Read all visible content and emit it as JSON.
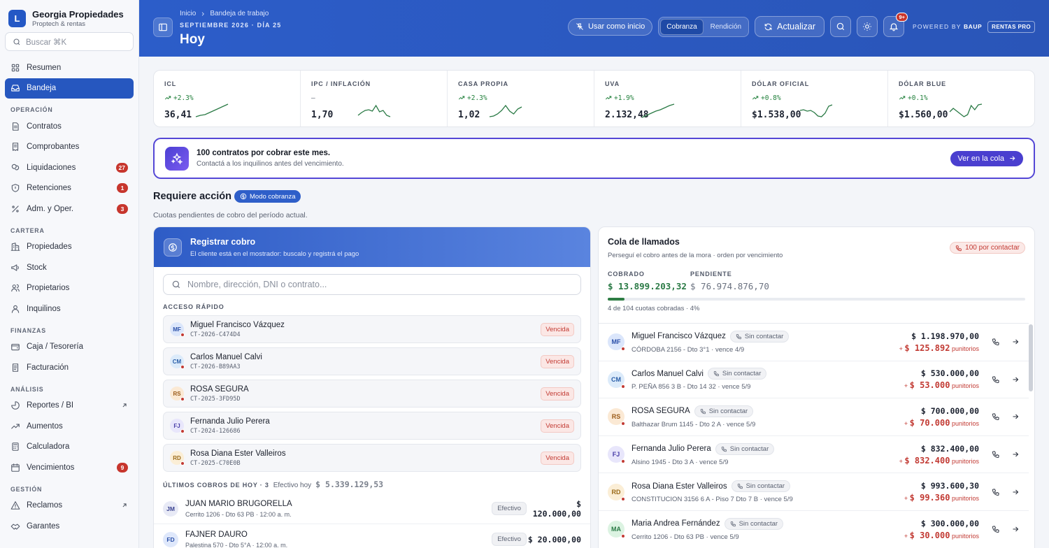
{
  "brand": {
    "logo": "L",
    "name": "Georgia Propiedades",
    "tagline": "Proptech & rentas"
  },
  "sidebar": {
    "search_placeholder": "Buscar ⌘K",
    "top_items": [
      {
        "label": "Resumen",
        "icon": "grid-icon"
      },
      {
        "label": "Bandeja",
        "icon": "inbox-icon",
        "active": true
      }
    ],
    "sections": [
      {
        "title": "OPERACIÓN",
        "items": [
          {
            "label": "Contratos",
            "icon": "document-icon"
          },
          {
            "label": "Comprobantes",
            "icon": "receipt-icon"
          },
          {
            "label": "Liquidaciones",
            "icon": "coins-icon",
            "badge": "27"
          },
          {
            "label": "Retenciones",
            "icon": "shield-icon",
            "badge": "1"
          },
          {
            "label": "Adm. y Oper.",
            "icon": "percent-icon",
            "badge": "3"
          }
        ]
      },
      {
        "title": "CARTERA",
        "items": [
          {
            "label": "Propiedades",
            "icon": "building-icon"
          },
          {
            "label": "Stock",
            "icon": "megaphone-icon"
          },
          {
            "label": "Propietarios",
            "icon": "users-icon"
          },
          {
            "label": "Inquilinos",
            "icon": "user-icon"
          }
        ]
      },
      {
        "title": "FINANZAS",
        "items": [
          {
            "label": "Caja / Tesorería",
            "icon": "wallet-icon"
          },
          {
            "label": "Facturación",
            "icon": "invoice-icon"
          }
        ]
      },
      {
        "title": "ANÁLISIS",
        "items": [
          {
            "label": "Reportes / BI",
            "icon": "chart-icon",
            "external": true
          },
          {
            "label": "Aumentos",
            "icon": "trend-up-icon"
          },
          {
            "label": "Calculadora",
            "icon": "calculator-icon"
          },
          {
            "label": "Vencimientos",
            "icon": "calendar-icon",
            "badge": "9"
          }
        ]
      },
      {
        "title": "GESTIÓN",
        "items": [
          {
            "label": "Reclamos",
            "icon": "warning-icon",
            "external": true
          },
          {
            "label": "Garantes",
            "icon": "handshake-icon"
          }
        ]
      }
    ]
  },
  "header": {
    "breadcrumb": [
      "Inicio",
      "Bandeja de trabajo"
    ],
    "date": "SEPTIEMBRE 2026 · DÍA 25",
    "title": "Hoy",
    "use_as_home": "Usar como inicio",
    "segments": [
      "Cobranza",
      "Rendición"
    ],
    "refresh": "Actualizar",
    "notif_count": "9+",
    "powered": "POWERED BY",
    "powered_brand": "BAUP",
    "plan": "RENTAS PRO"
  },
  "indicators": [
    {
      "name": "ICL",
      "change": "+2.3%",
      "value": "36,41",
      "trend": [
        0.1,
        0.2,
        0.25,
        0.4,
        0.55,
        0.7,
        0.85,
        1.0
      ]
    },
    {
      "name": "IPC / INFLACIÓN",
      "change": "–",
      "value": "1,70",
      "trend": [
        0.2,
        0.4,
        0.55,
        0.6,
        0.5,
        0.9,
        0.45,
        0.55,
        0.2,
        0.1
      ]
    },
    {
      "name": "CASA PROPIA",
      "change": "+2.3%",
      "value": "1,02",
      "trend": [
        0.1,
        0.15,
        0.3,
        0.55,
        0.9,
        0.5,
        0.3,
        0.65,
        0.8
      ]
    },
    {
      "name": "UVA",
      "change": "+1.9%",
      "value": "2.132,48",
      "trend": [
        0.05,
        0.2,
        0.35,
        0.5,
        0.6,
        0.75,
        0.9,
        1.0
      ]
    },
    {
      "name": "DÓLAR OFICIAL",
      "change": "+0.8%",
      "value": "$1.538,00",
      "trend": [
        0.55,
        0.6,
        0.5,
        0.55,
        0.4,
        0.15,
        0.1,
        0.35,
        0.85,
        0.95
      ]
    },
    {
      "name": "DÓLAR BLUE",
      "change": "+0.1%",
      "value": "$1.560,00",
      "trend": [
        0.45,
        0.7,
        0.5,
        0.3,
        0.1,
        0.25,
        0.9,
        0.6,
        0.95,
        1.0
      ]
    }
  ],
  "banner": {
    "title": "100 contratos por cobrar este mes.",
    "subtitle": "Contactá a los inquilinos antes del vencimiento.",
    "button": "Ver en la cola"
  },
  "section": {
    "title": "Requiere acción",
    "mode": "Modo cobranza",
    "subtitle": "Cuotas pendientes de cobro del período actual."
  },
  "registrar": {
    "title": "Registrar cobro",
    "subtitle": "El cliente está en el mostrador: buscalo y registrá el pago",
    "search_placeholder": "Nombre, dirección, DNI o contrato...",
    "quick_label": "ACCESO RÁPIDO",
    "quick": [
      {
        "initials": "MF",
        "name": "Miguel Francisco Vázquez",
        "code": "CT-2026-C474D4",
        "status": "Vencida",
        "color": "#dbe6fb",
        "fg": "#2a4fa8"
      },
      {
        "initials": "CM",
        "name": "Carlos Manuel Calvi",
        "code": "CT-2026-B89AA3",
        "status": "Vencida",
        "color": "#dcebfa",
        "fg": "#2a5ea8"
      },
      {
        "initials": "RS",
        "name": "ROSA SEGURA",
        "code": "CT-2025-3FD95D",
        "status": "Vencida",
        "color": "#fbe9d4",
        "fg": "#9a5a18"
      },
      {
        "initials": "FJ",
        "name": "Fernanda Julio Perera",
        "code": "CT-2024-126686",
        "status": "Vencida",
        "color": "#e8e6fb",
        "fg": "#4a3fa8"
      },
      {
        "initials": "RD",
        "name": "Rosa Diana Ester Valleiros",
        "code": "CT-2025-C70E0B",
        "status": "Vencida",
        "color": "#fbeed6",
        "fg": "#9a6a18"
      }
    ],
    "last_label": "ÚLTIMOS COBROS DE HOY · 3",
    "cash_label": "Efectivo hoy",
    "cash_value": "$ 5.339.129,53",
    "payments": [
      {
        "initials": "JM",
        "name": "JUAN MARIO BRUGORELLA",
        "addr": "Cerrito 1206 - Dto 63 PB · 12:00 a. m.",
        "method": "Efectivo",
        "amount": "$ 120.000,00",
        "color": "#e8eaf6",
        "fg": "#3a4290"
      },
      {
        "initials": "FD",
        "name": "FAJNER DAURO",
        "addr": "Palestina 570 - Dto 5°A · 12:00 a. m.",
        "method": "Efectivo",
        "amount": "$ 20.000,00",
        "color": "#dfe8fb",
        "fg": "#2a4fa8"
      }
    ]
  },
  "cola": {
    "title": "Cola de llamados",
    "subtitle": "Perseguí el cobro antes de la mora · orden por vencimiento",
    "badge": "100 por contactar",
    "cobrado_label": "COBRADO",
    "cobrado_value": "$ 13.899.203,32",
    "pendiente_label": "PENDIENTE",
    "pendiente_value": "$ 76.974.876,70",
    "progress": 0.04,
    "progress_text": "4 de 104 cuotas cobradas · 4%",
    "contact_status": "Sin contactar",
    "punitorios_label": "punitorios",
    "rows": [
      {
        "initials": "MF",
        "name": "Miguel Francisco Vázquez",
        "addr": "CÓRDOBA 2156 - Dto 3°1 · vence 4/9",
        "amount": "$ 1.198.970,00",
        "penalty": "$ 125.892",
        "color": "#dbe6fb",
        "fg": "#2a4fa8"
      },
      {
        "initials": "CM",
        "name": "Carlos Manuel Calvi",
        "addr": "P. PEÑA 856 3 B - Dto 14 32 · vence 5/9",
        "amount": "$ 530.000,00",
        "penalty": "$ 53.000",
        "color": "#dcebfa",
        "fg": "#2a5ea8"
      },
      {
        "initials": "RS",
        "name": "ROSA SEGURA",
        "addr": "Balthazar Brum 1145 - Dto 2 A · vence 5/9",
        "amount": "$ 700.000,00",
        "penalty": "$ 70.000",
        "color": "#fbe9d4",
        "fg": "#9a5a18"
      },
      {
        "initials": "FJ",
        "name": "Fernanda Julio Perera",
        "addr": "Alsino 1945 - Dto 3 A · vence 5/9",
        "amount": "$ 832.400,00",
        "penalty": "$ 832.400",
        "color": "#e8e6fb",
        "fg": "#4a3fa8"
      },
      {
        "initials": "RD",
        "name": "Rosa Diana Ester Valleiros",
        "addr": "CONSTITUCION 3156 6 A - Piso 7 Dto 7 B · vence 5/9",
        "amount": "$ 993.600,30",
        "penalty": "$ 99.360",
        "color": "#fbeed6",
        "fg": "#9a6a18"
      },
      {
        "initials": "MA",
        "name": "Maria Andrea Fernández",
        "addr": "Cerrito 1206 - Dto 63 PB · vence 5/9",
        "amount": "$ 300.000,00",
        "penalty": "$ 30.000",
        "color": "#dcf3e2",
        "fg": "#2a7a45"
      }
    ]
  }
}
